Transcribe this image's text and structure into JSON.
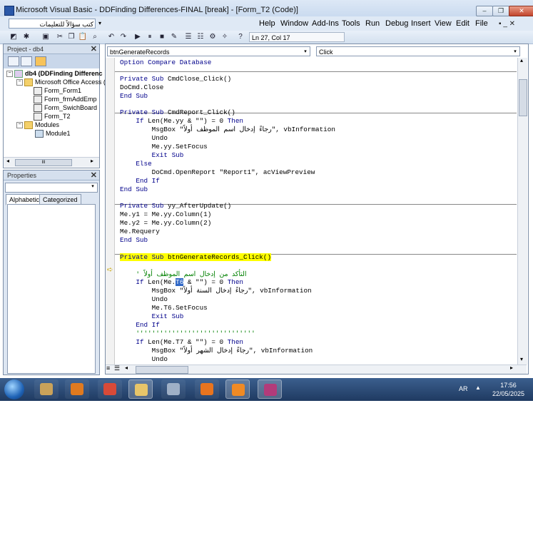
{
  "window": {
    "title": "Microsoft Visual Basic - DDFinding Differences-FINAL [break] - [Form_T2 (Code)]",
    "buttons": {
      "minimize": "–",
      "restore": "❐",
      "close": "✕"
    }
  },
  "menubar": {
    "ask_placeholder": "كتب سؤالاً للتعليمات",
    "items": [
      "Help",
      "Window",
      "Add-Ins",
      "Tools",
      "Run",
      "Debug",
      "Insert",
      "View",
      "Edit",
      "File"
    ],
    "mdi_controls": "▪ _ ✕"
  },
  "toolbar": {
    "position": "Ln 27, Col 17"
  },
  "project_pane": {
    "title": "Project - db4",
    "close": "✕",
    "tree": [
      {
        "label": "db4 (DDFinding Differenc",
        "level": 0,
        "expand": "−",
        "bold": true
      },
      {
        "label": "Microsoft Office Access (",
        "level": 1,
        "expand": "−"
      },
      {
        "label": "Form_Form1",
        "level": 2
      },
      {
        "label": "Form_frmAddEmp",
        "level": 2
      },
      {
        "label": "Form_SwichBoard",
        "level": 2
      },
      {
        "label": "Form_T2",
        "level": 2
      },
      {
        "label": "Modules",
        "level": 1,
        "expand": "−"
      },
      {
        "label": "Module1",
        "level": 2
      }
    ],
    "scroll_label": "III"
  },
  "properties_pane": {
    "title": "Properties",
    "close": "✕",
    "tabs": [
      "Alphabetic",
      "Categorized"
    ]
  },
  "code_window": {
    "object_combo": "btnGenerateRecords",
    "procedure_combo": "Click",
    "lines": [
      "Option Compare Database",
      "",
      "Private Sub CmdClose_Click()",
      "DoCmd.Close",
      "End Sub",
      "",
      "Private Sub CmdReport_Click()",
      "    If Len(Me.yy & \"\") = 0 Then",
      "        MsgBox \"رجاءً إدخال اسم الموظف أولاً\", vbInformation",
      "        Undo",
      "        Me.yy.SetFocus",
      "        Exit Sub",
      "    Else",
      "        DoCmd.OpenReport \"Report1\", acViewPreview",
      "    End If",
      "End Sub",
      "",
      "Private Sub yy_AfterUpdate()",
      "Me.y1 = Me.yy.Column(1)",
      "Me.y2 = Me.yy.Column(2)",
      "Me.Requery",
      "End Sub",
      "",
      "Private Sub btnGenerateRecords_Click()",
      "",
      "    ' التأكد من إدخال اسم الموظف أولاً",
      "    If Len(Me.T6 & \"\") = 0 Then",
      "        MsgBox \"رجاءً إدخال السنة أولاً\", vbInformation",
      "        Undo",
      "        Me.T6.SetFocus",
      "        Exit Sub",
      "    End If",
      "    ''''''''''''''''''''''''''''''",
      "    If Len(Me.T7 & \"\") = 0 Then",
      "        MsgBox \"رجاءً إدخال الشهر أولاً\", vbInformation",
      "        Undo"
    ],
    "exec_arrow": "➪"
  },
  "taskbar": {
    "language": "AR",
    "tray": "▲",
    "time": "17:56",
    "date": "22/05/2025",
    "apps": [
      {
        "name": "paint-app",
        "color": "#c9a25a",
        "state": "pinned"
      },
      {
        "name": "media-player-app",
        "color": "#e07a1f",
        "state": "pinned"
      },
      {
        "name": "chrome-app",
        "color": "#d84a38",
        "state": "pinned"
      },
      {
        "name": "explorer-app",
        "color": "#e7c569",
        "state": "open"
      },
      {
        "name": "calculator-app",
        "color": "#9fb0c6",
        "state": "pinned"
      },
      {
        "name": "pinned-app",
        "color": "#e8741e",
        "state": "pinned"
      },
      {
        "name": "firefox-app",
        "color": "#f08a24",
        "state": "open"
      },
      {
        "name": "vba-editor-app",
        "color": "#b23b7a",
        "state": "open"
      }
    ]
  }
}
